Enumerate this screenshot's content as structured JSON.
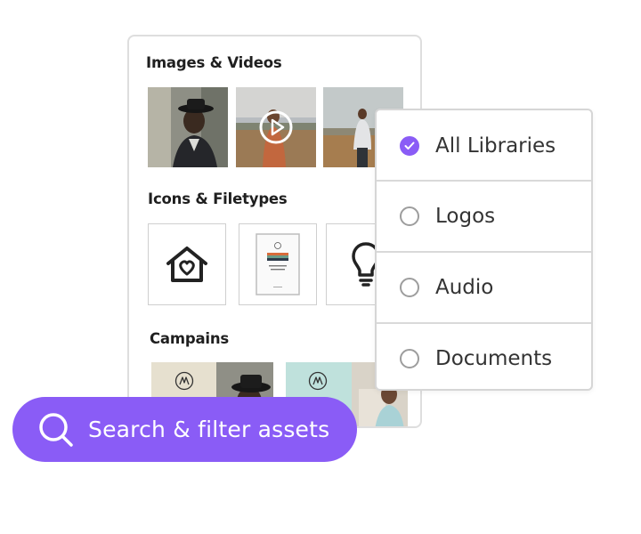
{
  "panel": {
    "sections": [
      {
        "title": "Images & Videos"
      },
      {
        "title": "Icons & Filetypes"
      },
      {
        "title": "Campains"
      }
    ],
    "thumbnails": [
      {
        "name": "portrait-man-hat",
        "kind": "image"
      },
      {
        "name": "woman-field",
        "kind": "video",
        "icon": "play-icon"
      },
      {
        "name": "man-field",
        "kind": "image"
      }
    ],
    "icons": [
      {
        "name": "house-heart-icon"
      },
      {
        "name": "document-thumbnail"
      },
      {
        "name": "lightbulb-icon"
      }
    ],
    "campaigns": [
      {
        "name": "campaign-card-1",
        "logo_icon": "brand-m-icon"
      },
      {
        "name": "campaign-card-2",
        "logo_icon": "brand-m-icon"
      }
    ]
  },
  "filter": {
    "options": [
      {
        "label": "All Libraries",
        "checked": true
      },
      {
        "label": "Logos",
        "checked": false
      },
      {
        "label": "Audio",
        "checked": false
      },
      {
        "label": "Documents",
        "checked": false
      }
    ]
  },
  "search": {
    "label": "Search & filter assets",
    "icon": "search-icon"
  },
  "colors": {
    "accent": "#8a5cf6",
    "border": "#dedede",
    "text": "#222222"
  }
}
